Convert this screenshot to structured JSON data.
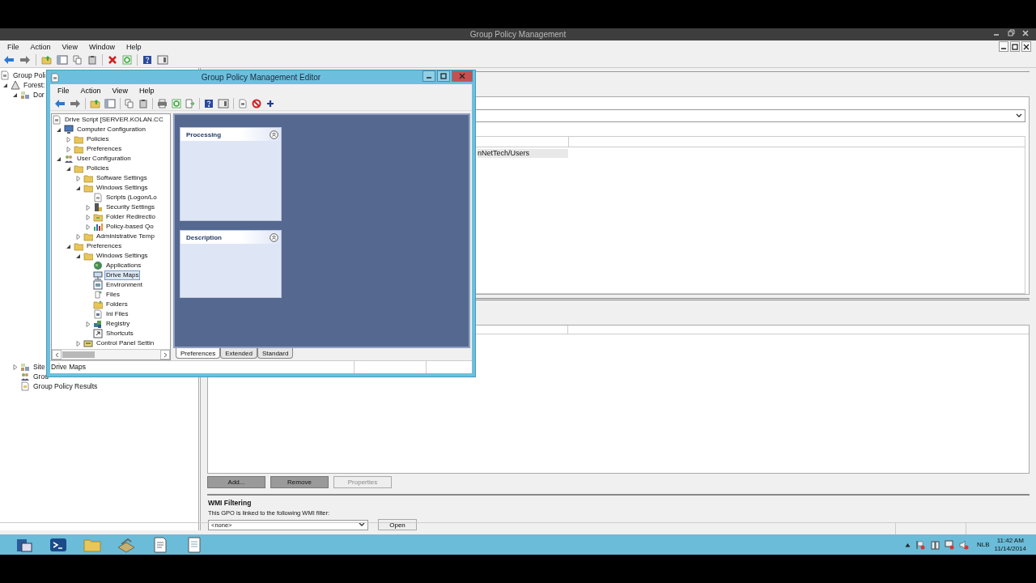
{
  "main_window": {
    "title": "Group Policy Management",
    "menu": [
      "File",
      "Action",
      "View",
      "Window",
      "Help"
    ],
    "tree": [
      {
        "label": "Group Poli",
        "kind": "console",
        "selected": false,
        "children": [
          {
            "label": "Forest:",
            "kind": "forest",
            "selected": false,
            "expanded": true,
            "children": [
              {
                "label": "Dor",
                "kind": "domain",
                "selected": false,
                "expanded": true
              },
              {
                "label": "Site",
                "kind": "sites",
                "selected": false,
                "expanded": false
              },
              {
                "label": "Grou",
                "kind": "modeling",
                "selected": false
              },
              {
                "label": "Group Policy Results",
                "kind": "results",
                "selected": false
              }
            ]
          }
        ]
      }
    ],
    "list_rows": [
      "nNetTech/Users"
    ],
    "buttons": [
      {
        "label": "Add...",
        "disabled": false
      },
      {
        "label": "Remove",
        "disabled": false
      },
      {
        "label": "Properties",
        "disabled": true
      }
    ],
    "wmi": {
      "heading": "WMI Filtering",
      "text": "This GPO is linked to the following WMI filter:",
      "filter": "<none>",
      "open_button": "Open"
    }
  },
  "editor_window": {
    "title": "Group Policy Management Editor",
    "menu": [
      "File",
      "Action",
      "View",
      "Help"
    ],
    "tree": [
      {
        "label": "Drive Script [SERVER.KOLAN.CC",
        "kind": "gpo",
        "selected": false,
        "children": [
          {
            "label": "Computer Configuration",
            "kind": "computer",
            "selected": false,
            "expanded": true,
            "children": [
              {
                "label": "Policies",
                "kind": "folder",
                "selected": false,
                "expanded": false
              },
              {
                "label": "Preferences",
                "kind": "folder",
                "selected": false,
                "expanded": false
              }
            ]
          },
          {
            "label": "User Configuration",
            "kind": "user",
            "selected": false,
            "expanded": true,
            "children": [
              {
                "label": "Policies",
                "kind": "folder",
                "selected": false,
                "expanded": true,
                "children": [
                  {
                    "label": "Software Settings",
                    "kind": "folder",
                    "selected": false,
                    "expanded": false
                  },
                  {
                    "label": "Windows Settings",
                    "kind": "folder",
                    "selected": false,
                    "expanded": true,
                    "children": [
                      {
                        "label": "Scripts (Logon/Lo",
                        "kind": "script",
                        "selected": false
                      },
                      {
                        "label": "Security Settings",
                        "kind": "security",
                        "selected": false,
                        "expanded": false
                      },
                      {
                        "label": "Folder Redirectio",
                        "kind": "redirect",
                        "selected": false,
                        "expanded": false
                      },
                      {
                        "label": "Policy-based Qo",
                        "kind": "qos",
                        "selected": false,
                        "expanded": false
                      }
                    ]
                  },
                  {
                    "label": "Administrative Temp",
                    "kind": "folder",
                    "selected": false,
                    "expanded": false
                  }
                ]
              },
              {
                "label": "Preferences",
                "kind": "folder",
                "selected": false,
                "expanded": true,
                "children": [
                  {
                    "label": "Windows Settings",
                    "kind": "folder",
                    "selected": false,
                    "expanded": true,
                    "children": [
                      {
                        "label": "Applications",
                        "kind": "globe",
                        "selected": false
                      },
                      {
                        "label": "Drive Maps",
                        "kind": "drive",
                        "selected": true
                      },
                      {
                        "label": "Environment",
                        "kind": "env",
                        "selected": false
                      },
                      {
                        "label": "Files",
                        "kind": "files",
                        "selected": false
                      },
                      {
                        "label": "Folders",
                        "kind": "folders",
                        "selected": false
                      },
                      {
                        "label": "Ini Files",
                        "kind": "ini",
                        "selected": false
                      },
                      {
                        "label": "Registry",
                        "kind": "registry",
                        "selected": false,
                        "expanded": false
                      },
                      {
                        "label": "Shortcuts",
                        "kind": "shortcut",
                        "selected": false
                      }
                    ]
                  },
                  {
                    "label": "Control Panel Settin",
                    "kind": "control",
                    "selected": false,
                    "expanded": false
                  }
                ]
              }
            ]
          }
        ]
      }
    ],
    "panels": [
      {
        "title": "Processing",
        "expanded": true
      },
      {
        "title": "Description",
        "expanded": true
      }
    ],
    "tabs": [
      {
        "label": "Preferences",
        "selected": true
      },
      {
        "label": "Extended",
        "selected": false
      },
      {
        "label": "Standard",
        "selected": false
      }
    ],
    "status": "Drive Maps"
  },
  "taskbar": {
    "tray": {
      "language": "NLB",
      "time": "11:42 AM",
      "date": "11/14/2014"
    }
  }
}
